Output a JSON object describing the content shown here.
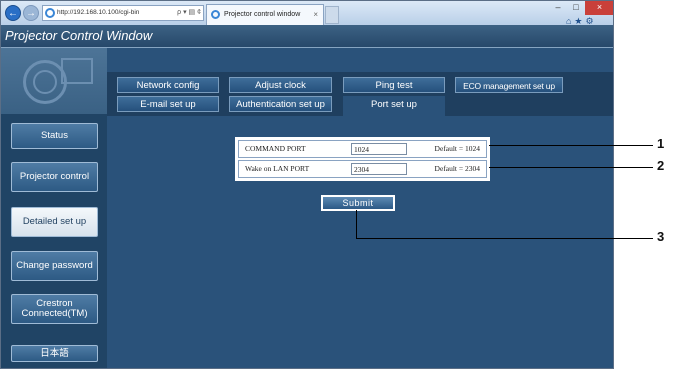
{
  "browser": {
    "url": "http://192.168.10.100/cgi-bin",
    "address_tools": "ρ ▾ ▤ ¢",
    "tab_title": "Projector control window",
    "tab_close": "×",
    "nav_back": "←",
    "nav_forward": "→",
    "minimize": "–",
    "maximize": "□",
    "close": "×",
    "toolbar_icons": "⌂★⚙"
  },
  "page": {
    "title": "Projector Control Window"
  },
  "sidebar": {
    "items": [
      {
        "label": "Status",
        "active": false
      },
      {
        "label": "Projector control",
        "active": false
      },
      {
        "label": "Detailed set up",
        "active": true
      },
      {
        "label": "Change password",
        "active": false
      },
      {
        "label": "Crestron Connected(TM)",
        "active": false
      },
      {
        "label": "日本語",
        "active": false
      }
    ]
  },
  "tabs": {
    "row1": [
      "Network config",
      "Adjust clock",
      "Ping test",
      "ECO management set up"
    ],
    "row2": [
      "E-mail set up",
      "Authentication set up",
      "Port set up"
    ],
    "active": "Port set up"
  },
  "settings": {
    "command_port": {
      "label": "COMMAND PORT",
      "value": "1024",
      "default": "Default = 1024"
    },
    "wol_port": {
      "label": "Wake on LAN PORT",
      "value": "2304",
      "default": "Default = 2304"
    }
  },
  "submit_label": "Submit",
  "callouts": [
    "1",
    "2",
    "3"
  ],
  "colors": {
    "page_bg": "#2a527a",
    "header_bg": "#27486a",
    "sidebar_bg": "#204465",
    "button_bg": "#2d5a84",
    "active_button_bg": "#f4f8fb"
  }
}
